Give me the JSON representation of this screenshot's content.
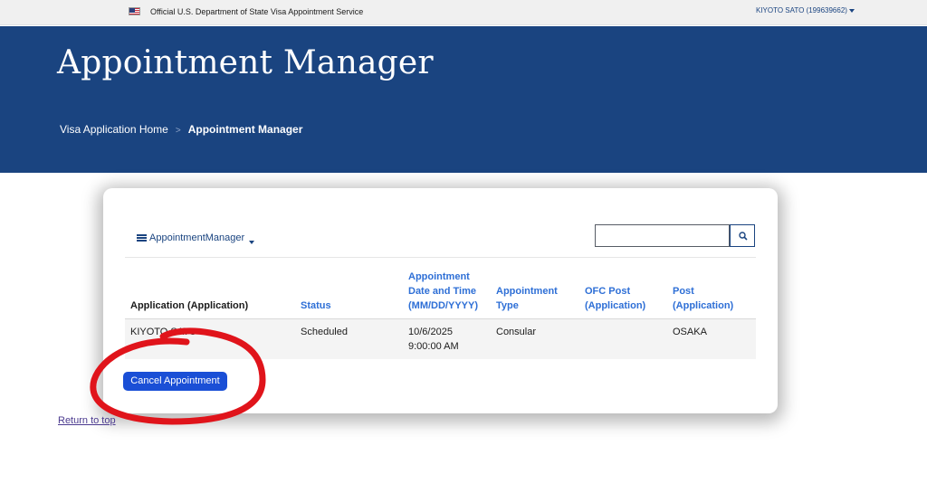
{
  "topbar": {
    "official_text": "Official U.S. Department of State Visa Appointment Service",
    "user_label": "KIYOTO SATO (199639662)",
    "flag_icon": "us-flag-icon",
    "caret_icon": "caret-down-icon"
  },
  "hero": {
    "title": "Appointment Manager",
    "breadcrumb": {
      "home": "Visa Application Home",
      "separator": ">",
      "current": "Appointment Manager"
    }
  },
  "manager": {
    "toggle_label": "AppointmentManager",
    "toggle_icon": "list-icon",
    "search_placeholder": "",
    "search_icon": "magnifier-icon"
  },
  "table": {
    "headers": {
      "application": "Application (Application)",
      "status": "Status",
      "date_line1": "Appointment",
      "date_line2": "Date and Time",
      "date_line3": "(MM/DD/YYYY)",
      "type_line1": "Appointment",
      "type_line2": "Type",
      "ofc_line1": "OFC Post",
      "ofc_line2": "(Application)",
      "post_line1": "Post",
      "post_line2": "(Application)"
    },
    "rows": [
      {
        "application": "KIYOTO SATO",
        "status": "Scheduled",
        "date": "10/6/2025",
        "time": "9:00:00 AM",
        "type": "Consular",
        "ofc_post": "",
        "post": "OSAKA"
      }
    ]
  },
  "actions": {
    "cancel_label": "Cancel Appointment"
  },
  "footer": {
    "return_top": "Return to top"
  },
  "colors": {
    "hero_bg": "#1a4480",
    "header_link": "#2e6fd6",
    "cancel_button": "#1a4fd6",
    "annotation": "#e0141b"
  }
}
